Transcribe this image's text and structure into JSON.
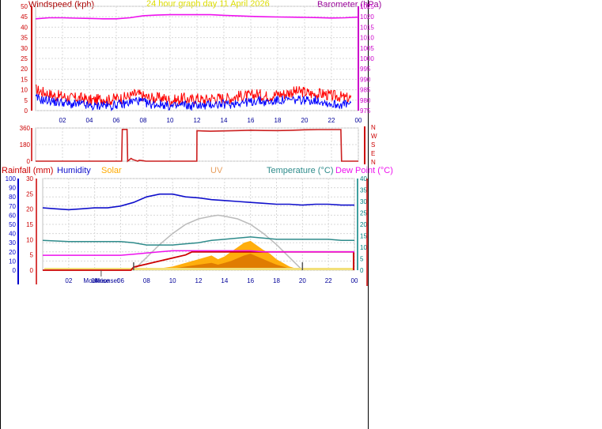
{
  "graph_title": "24 hour graph day   11 April 2026",
  "colors": {
    "wind": "#ff0000",
    "gust": "#0000ff",
    "baro": "#ee11ee",
    "wind_dir": "#cc2020",
    "rain": "#cc0000",
    "humidity": "#1010cc",
    "solar": "#ffaa00",
    "solar_dark": "#dd7700",
    "uv": "#e8a060",
    "temperature": "#2e8b8b",
    "dewpoint": "#ee11ee",
    "theoretical_solar": "#bbbbbb",
    "label_windspeed": "#aa0000",
    "label_baro": "#990099",
    "label_title": "#dddd00",
    "axis_blue": "#0000cc",
    "axis_red": "#cc0000",
    "axis_teal": "#008080",
    "axis_magenta": "#cc00cc",
    "tick_red": "#cc0000",
    "tick_blue": "#000099",
    "grid": "#d8d8d8",
    "marker": "#555555"
  },
  "x_tick_labels": [
    "02",
    "04",
    "06",
    "08",
    "10",
    "12",
    "14",
    "16",
    "18",
    "20",
    "22",
    "00"
  ],
  "chart_data": [
    {
      "type": "line",
      "id": "wind",
      "x_unit": "hour",
      "xlim": [
        0,
        24
      ],
      "ylim": [
        0,
        50
      ],
      "yticks": [
        0,
        5,
        10,
        15,
        20,
        25,
        30,
        35,
        40,
        45,
        50
      ],
      "y2lim": [
        975,
        1025
      ],
      "y2ticks": [
        975,
        980,
        985,
        990,
        995,
        1000,
        1005,
        1010,
        1015,
        1020,
        1025
      ],
      "y_label": "Windspeed (kph)",
      "y2_label": "Barometer (hPa)",
      "grid": true,
      "series": [
        {
          "name": "Windspeed (kph)",
          "axis": "left",
          "x": [
            0,
            0.5,
            1,
            1.5,
            2,
            2.5,
            3,
            3.5,
            4,
            4.5,
            5,
            5.5,
            6,
            6.5,
            7,
            7.5,
            8,
            8.5,
            9,
            9.5,
            10,
            10.5,
            11,
            11.5,
            12,
            12.5,
            13,
            13.5,
            14,
            14.5,
            15,
            15.5,
            16,
            16.5,
            17,
            17.5,
            18,
            18.5,
            19,
            19.5,
            20,
            20.5,
            21,
            21.5,
            22,
            22.5,
            23
          ],
          "values": [
            10,
            9,
            8,
            7,
            7,
            6,
            6,
            6,
            5,
            5,
            6,
            5,
            6,
            6,
            7,
            8,
            7,
            6,
            6,
            6,
            5,
            5,
            6,
            5,
            6,
            5,
            6,
            6,
            6,
            6,
            7,
            7,
            7,
            8,
            7,
            7,
            8,
            8,
            9,
            9,
            9,
            8,
            8,
            8,
            7,
            7,
            6
          ]
        },
        {
          "name": "Gust",
          "axis": "left",
          "x": [
            0,
            0.5,
            1,
            1.5,
            2,
            2.5,
            3,
            3.5,
            4,
            4.5,
            5,
            5.5,
            6,
            6.5,
            7,
            7.5,
            8,
            8.5,
            9,
            9.5,
            10,
            10.5,
            11,
            11.5,
            12,
            12.5,
            13,
            13.5,
            14,
            14.5,
            15,
            15.5,
            16,
            16.5,
            17,
            17.5,
            18,
            18.5,
            19,
            19.5,
            20,
            20.5,
            21,
            21.5,
            22,
            22.5,
            23
          ],
          "values": [
            6,
            5,
            5,
            4,
            4,
            3,
            3,
            3,
            2,
            2,
            3,
            2,
            3,
            3,
            4,
            5,
            4,
            3,
            3,
            3,
            2,
            2,
            3,
            2,
            3,
            2,
            3,
            3,
            3,
            3,
            4,
            4,
            4,
            5,
            4,
            4,
            5,
            5,
            5,
            5,
            5,
            5,
            5,
            4,
            3,
            3,
            3
          ]
        },
        {
          "name": "Barometer (hPa)",
          "axis": "right",
          "x": [
            0,
            1,
            2,
            3,
            4,
            5,
            6,
            7,
            8,
            9,
            10,
            11,
            12,
            13,
            14,
            15,
            16,
            17,
            18,
            19,
            20,
            21,
            22,
            23,
            24
          ],
          "values": [
            1019,
            1019.5,
            1019.5,
            1019.3,
            1019.2,
            1019,
            1019,
            1019.5,
            1020.5,
            1020.8,
            1021,
            1021,
            1021,
            1021,
            1020.7,
            1020.4,
            1020.2,
            1020,
            1019.9,
            1019.8,
            1019.7,
            1019.6,
            1019.4,
            1019.5,
            1019.8
          ]
        }
      ]
    },
    {
      "type": "line",
      "id": "wind_direction",
      "x_unit": "hour",
      "xlim": [
        0,
        24
      ],
      "ylim": [
        0,
        360
      ],
      "yticks": [
        0,
        180,
        360
      ],
      "compass_labels": [
        "N",
        "W",
        "S",
        "E",
        "N"
      ],
      "grid": true,
      "series": [
        {
          "name": "Wind direction",
          "x": [
            0,
            6.4,
            6.45,
            6.8,
            6.85,
            7.1,
            7.2,
            7.6,
            7.7,
            8,
            8.2,
            11.99,
            12,
            13,
            14,
            15,
            16,
            17,
            18,
            19,
            20,
            21,
            22,
            22.7,
            22.75,
            24
          ],
          "values": [
            0,
            0,
            345,
            345,
            0,
            30,
            20,
            0,
            10,
            5,
            0,
            0,
            330,
            325,
            328,
            332,
            336,
            333,
            332,
            335,
            340,
            343,
            343,
            343,
            0,
            0
          ]
        }
      ]
    },
    {
      "type": "area",
      "id": "multi",
      "x_unit": "hour",
      "xlim": [
        0,
        24
      ],
      "ylim": [
        0,
        100
      ],
      "yticks": [
        0,
        10,
        20,
        30,
        40,
        50,
        60,
        70,
        80,
        90,
        100
      ],
      "y2lim": [
        0,
        30
      ],
      "y2ticks": [
        0,
        5,
        10,
        15,
        20,
        25,
        30
      ],
      "y3lim": [
        0,
        40
      ],
      "y3ticks": [
        0,
        5,
        10,
        15,
        20,
        25,
        30,
        35,
        40
      ],
      "labels": [
        "Rainfall (mm)",
        "Humidity",
        "Solar",
        "UV",
        "Temperature (°C)",
        "Dew Point (°C)"
      ],
      "markers": [
        "Moonrise",
        "Moonset"
      ],
      "grid": true,
      "series": [
        {
          "name": "Humidity",
          "axis": "left_pct",
          "x": [
            0,
            1,
            2,
            3,
            4,
            5,
            6,
            7,
            8,
            9,
            10,
            11,
            12,
            13,
            14,
            15,
            16,
            17,
            18,
            19,
            20,
            21,
            22,
            23,
            24
          ],
          "values": [
            68,
            67,
            66,
            67,
            68,
            68,
            70,
            74,
            80,
            83,
            83,
            80,
            79,
            77,
            76,
            75,
            74,
            73,
            72,
            72,
            71,
            72,
            72,
            71,
            71
          ]
        },
        {
          "name": "Temperature (°C)",
          "axis": "temp",
          "x": [
            0,
            2,
            4,
            6,
            7,
            8,
            9,
            10,
            11,
            12,
            13,
            14,
            15,
            16,
            17,
            18,
            19,
            20,
            21,
            22,
            23,
            24
          ],
          "values": [
            13,
            12.5,
            12.5,
            12.5,
            12,
            11,
            11,
            11,
            11.5,
            12,
            13,
            13.5,
            14,
            14.5,
            14,
            13.5,
            13.5,
            13.5,
            13.5,
            13.5,
            13,
            13
          ]
        },
        {
          "name": "Dew Point (°C)",
          "axis": "temp",
          "x": [
            0,
            2,
            4,
            6,
            7,
            8,
            9,
            10,
            11,
            12,
            13,
            14,
            15,
            16,
            17,
            18,
            19,
            20,
            21,
            22,
            23,
            24
          ],
          "values": [
            6.5,
            6.5,
            6.5,
            6.5,
            7,
            7.5,
            8,
            8.5,
            8.5,
            8.5,
            8.5,
            8.5,
            8.5,
            8.5,
            8,
            8,
            8,
            8,
            8,
            8,
            8,
            8
          ]
        },
        {
          "name": "Rainfall (mm)",
          "axis": "rain",
          "x": [
            0,
            6.8,
            7,
            8,
            9,
            10,
            11,
            11.5,
            24
          ],
          "values": [
            0,
            0,
            1,
            2,
            3,
            4,
            5,
            6,
            6
          ]
        },
        {
          "name": "Solar",
          "axis": "left_pct",
          "x": [
            7,
            8,
            9,
            10,
            11,
            12,
            12.5,
            13,
            13.5,
            14,
            14.5,
            15,
            15.5,
            16,
            16.5,
            17,
            17.5,
            18,
            18.5,
            19,
            19.5,
            20
          ],
          "values": [
            0,
            1,
            2,
            4,
            8,
            12,
            14,
            16,
            12,
            15,
            20,
            25,
            30,
            32,
            27,
            22,
            18,
            12,
            8,
            4,
            2,
            0
          ]
        },
        {
          "name": "UV",
          "axis": "left_pct",
          "x": [
            7,
            8,
            9,
            10,
            11,
            12,
            12.5,
            13,
            13.5,
            14,
            14.5,
            15,
            15.5,
            16,
            16.5,
            17,
            17.5,
            18,
            18.5,
            19,
            19.5,
            20
          ],
          "values": [
            0,
            0.5,
            1,
            2,
            4,
            6,
            7,
            8,
            6,
            8,
            10,
            13,
            16,
            18,
            15,
            12,
            9,
            6,
            4,
            2,
            1,
            0
          ]
        },
        {
          "name": "Theoretical solar",
          "axis": "left_pct",
          "x": [
            7,
            8,
            9,
            10,
            11,
            12,
            13,
            13.5,
            14,
            15,
            16,
            17,
            18,
            19,
            20
          ],
          "values": [
            0,
            14,
            28,
            40,
            50,
            56,
            59,
            60,
            59,
            56,
            50,
            40,
            28,
            14,
            0
          ]
        }
      ]
    }
  ]
}
